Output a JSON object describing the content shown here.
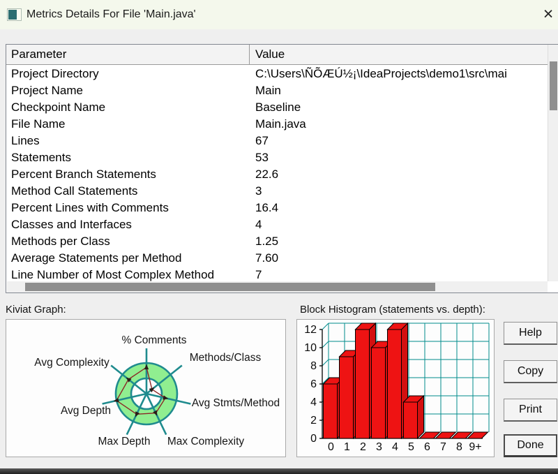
{
  "window": {
    "title": "Metrics Details For File 'Main.java'",
    "close_glyph": "×"
  },
  "table": {
    "columns": [
      "Parameter",
      "Value"
    ],
    "rows": [
      {
        "parameter": "Project Directory",
        "value": "C:\\Users\\ÑÕÆÚ½¡\\IdeaProjects\\demo1\\src\\mai"
      },
      {
        "parameter": "Project Name",
        "value": "Main"
      },
      {
        "parameter": "Checkpoint Name",
        "value": "Baseline"
      },
      {
        "parameter": "File Name",
        "value": "Main.java"
      },
      {
        "parameter": "Lines",
        "value": "67"
      },
      {
        "parameter": "Statements",
        "value": "53"
      },
      {
        "parameter": "Percent Branch Statements",
        "value": "22.6"
      },
      {
        "parameter": "Method Call Statements",
        "value": "3"
      },
      {
        "parameter": "Percent Lines with Comments",
        "value": "16.4"
      },
      {
        "parameter": "Classes and Interfaces",
        "value": "4"
      },
      {
        "parameter": "Methods per Class",
        "value": "1.25"
      },
      {
        "parameter": "Average Statements per Method",
        "value": "7.60"
      },
      {
        "parameter": "Line Number of Most Complex Method",
        "value": "7"
      }
    ]
  },
  "sections": {
    "kiviat_label": "Kiviat Graph:",
    "histogram_label": "Block Histogram (statements vs. depth):"
  },
  "buttons": [
    {
      "label": "Help"
    },
    {
      "label": "Copy"
    },
    {
      "label": "Print"
    },
    {
      "label": "Done"
    }
  ],
  "chart_data": [
    {
      "type": "radar",
      "title": "Kiviat Graph",
      "axes": [
        "% Comments",
        "Methods/Class",
        "Avg Stmts/Method",
        "Max Complexity",
        "Max Depth",
        "Avg Depth",
        "Avg Complexity"
      ],
      "axes_order": "clockwise from top",
      "values_radius_fraction": [
        0.86,
        0.23,
        0.63,
        0.7,
        0.74,
        1.0,
        0.75
      ],
      "ring_inner_fraction": 0.5,
      "legend": "green annulus = acceptable band, dark-red polygon = metric values",
      "colors": {
        "ring_fill": "#90ee90",
        "axis": "#1f8b8e",
        "data_line": "#8b2727",
        "marker": "#2a1c17",
        "inner_fill": "#ffffff"
      }
    },
    {
      "type": "bar",
      "title": "Block Histogram (statements vs. depth)",
      "categories": [
        "0",
        "1",
        "2",
        "3",
        "4",
        "5",
        "6",
        "7",
        "8",
        "9+"
      ],
      "values": [
        6,
        9,
        12,
        10,
        12,
        4,
        0,
        0,
        0,
        0
      ],
      "ylim": [
        0,
        12
      ],
      "yticks": [
        0,
        2,
        4,
        6,
        8,
        10,
        12
      ],
      "grid": true,
      "style": "3d",
      "colors": {
        "bar": "#ee1313",
        "bar_side": "#d31010",
        "grid": "#008b8b",
        "axis": "#000000"
      }
    }
  ]
}
